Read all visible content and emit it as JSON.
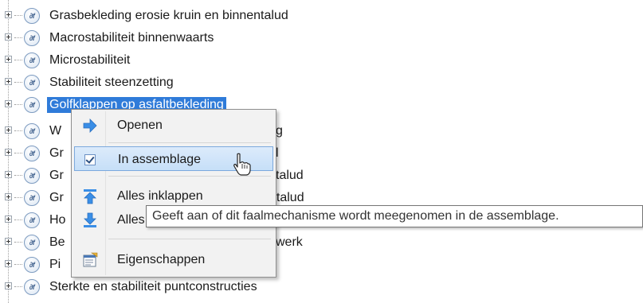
{
  "tree": {
    "items": [
      {
        "label": "Grasbekleding erosie kruin en binnentalud",
        "icon": "failure-mechanism-icon"
      },
      {
        "label": "Macrostabiliteit binnenwaarts",
        "icon": "failure-mechanism-icon"
      },
      {
        "label": "Microstabiliteit",
        "icon": "failure-mechanism-icon"
      },
      {
        "label": "Stabiliteit steenzetting",
        "icon": "failure-mechanism-icon"
      },
      {
        "label": "Golfklappen op asfaltbekleding",
        "icon": "failure-mechanism-icon",
        "selected": true
      },
      {
        "label": "W",
        "visible_end": "g",
        "icon": "failure-mechanism-icon"
      },
      {
        "label": "Gr",
        "visible_end": "l",
        "icon": "failure-mechanism-icon"
      },
      {
        "label": "Gr",
        "visible_end": "talud",
        "icon": "failure-mechanism-icon"
      },
      {
        "label": "Gr",
        "visible_end": "ntalud",
        "icon": "failure-mechanism-icon"
      },
      {
        "label": "Ho",
        "icon": "failure-mechanism-icon"
      },
      {
        "label": "Be",
        "visible_end": "werk",
        "icon": "failure-mechanism-icon"
      },
      {
        "label": "Pi",
        "icon": "failure-mechanism-icon"
      },
      {
        "label": "Sterkte en stabiliteit puntconstructies",
        "icon": "failure-mechanism-icon"
      }
    ],
    "icon_text": "∂f"
  },
  "context_menu": {
    "items": [
      {
        "label": "Openen",
        "icon": "arrow-right-icon"
      },
      {
        "label": "In assemblage",
        "icon": "checkbox-checked-icon",
        "checked": true,
        "hovered": true
      },
      {
        "label": "Alles inklappen",
        "icon": "collapse-all-icon"
      },
      {
        "label": "Alles uitklappen",
        "icon": "expand-all-icon"
      },
      {
        "label": "Eigenschappen",
        "icon": "properties-icon"
      }
    ]
  },
  "tooltip": {
    "text": "Geeft aan of dit faalmechanisme wordt meegenomen in de assemblage."
  },
  "colors": {
    "selection": "#2f7bd9",
    "menu_hover": "#c6dff8",
    "arrow_blue": "#3a8ee6"
  }
}
